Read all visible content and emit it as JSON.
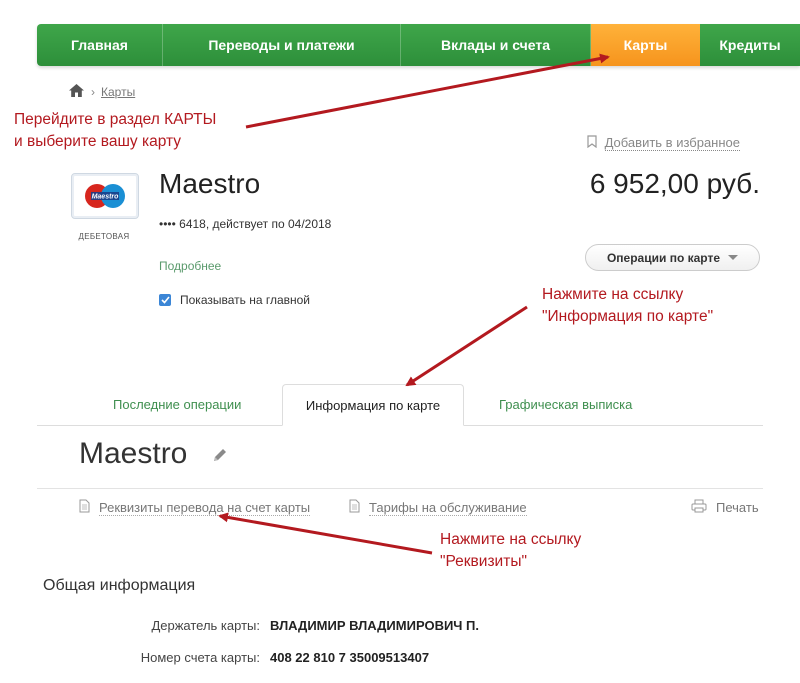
{
  "nav": {
    "items": [
      {
        "label": "Главная"
      },
      {
        "label": "Переводы и платежи"
      },
      {
        "label": "Вклады и счета"
      },
      {
        "label": "Карты",
        "active": true
      },
      {
        "label": "Кредиты"
      }
    ],
    "colors": {
      "green": "#34a043",
      "active": "#f8a127"
    }
  },
  "breadcrumb": {
    "home_icon": "home-icon",
    "current": "Карты"
  },
  "favorites": {
    "label": "Добавить в избранное",
    "icon": "bookmark-icon"
  },
  "card": {
    "logo_text": "Maestro",
    "type": "ДЕБЕТОВАЯ",
    "name": "Maestro",
    "number_line": "•••• 6418, действует по 04/2018",
    "more_link": "Подробнее",
    "show_on_main": "Показывать на главной",
    "balance": "6 952,00 руб.",
    "operations_button": "Операции по карте"
  },
  "annotations": {
    "step1_line1": "Перейдите в раздел КАРТЫ",
    "step1_line2": "и выберите вашу карту",
    "step2_line1": "Нажмите на ссылку",
    "step2_line2": "\"Информация по карте\"",
    "step3_line1": "Нажмите на ссылку",
    "step3_line2": "\"Реквизиты\"",
    "color": "#b3191f"
  },
  "tabs": [
    {
      "label": "Последние операции"
    },
    {
      "label": "Информация по карте",
      "active": true
    },
    {
      "label": "Графическая выписка"
    }
  ],
  "section": {
    "title": "Maestro",
    "links": {
      "requisites": "Реквизиты перевода на счет карты",
      "tariffs": "Тарифы на обслуживание",
      "print": "Печать"
    },
    "general_info": "Общая информация",
    "holder_label": "Держатель карты:",
    "holder_value": "ВЛАДИМИР ВЛАДИМИРОВИЧ П.",
    "account_label": "Номер счета карты:",
    "account_value": "408 22 810 7 35009513407"
  }
}
